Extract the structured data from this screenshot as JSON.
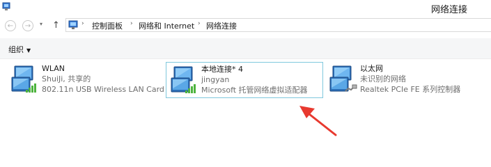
{
  "window": {
    "title": "网络连接"
  },
  "nav": {
    "back_glyph": "←",
    "forward_glyph": "→",
    "dropdown_glyph": "▾",
    "up_glyph": "↑",
    "separator": "›",
    "breadcrumbs": [
      "控制面板",
      "网络和 Internet",
      "网络连接"
    ]
  },
  "toolbar": {
    "organize_label": "组织",
    "organize_caret": "▼"
  },
  "connections": [
    {
      "name": "WLAN",
      "status": "ShuiJi, 共享的",
      "adapter": "802.11n USB Wireless LAN Card",
      "icon": "wifi-adapter-icon",
      "selected": false
    },
    {
      "name": "本地连接* 4",
      "status": "jingyan",
      "adapter": "Microsoft 托管网络虚拟适配器",
      "icon": "wifi-adapter-icon",
      "selected": true
    },
    {
      "name": "以太网",
      "status": "未识别的网络",
      "adapter": "Realtek PCIe FE 系列控制器",
      "icon": "ethernet-adapter-icon",
      "selected": false
    }
  ],
  "annotation": {
    "arrow_color": "#e8392f",
    "icon": "red-arrow-icon"
  },
  "colors": {
    "selection_border": "#7fc8dd",
    "toolbar_bg": "#f5f6f7",
    "status_text": "#6d6d6d"
  }
}
